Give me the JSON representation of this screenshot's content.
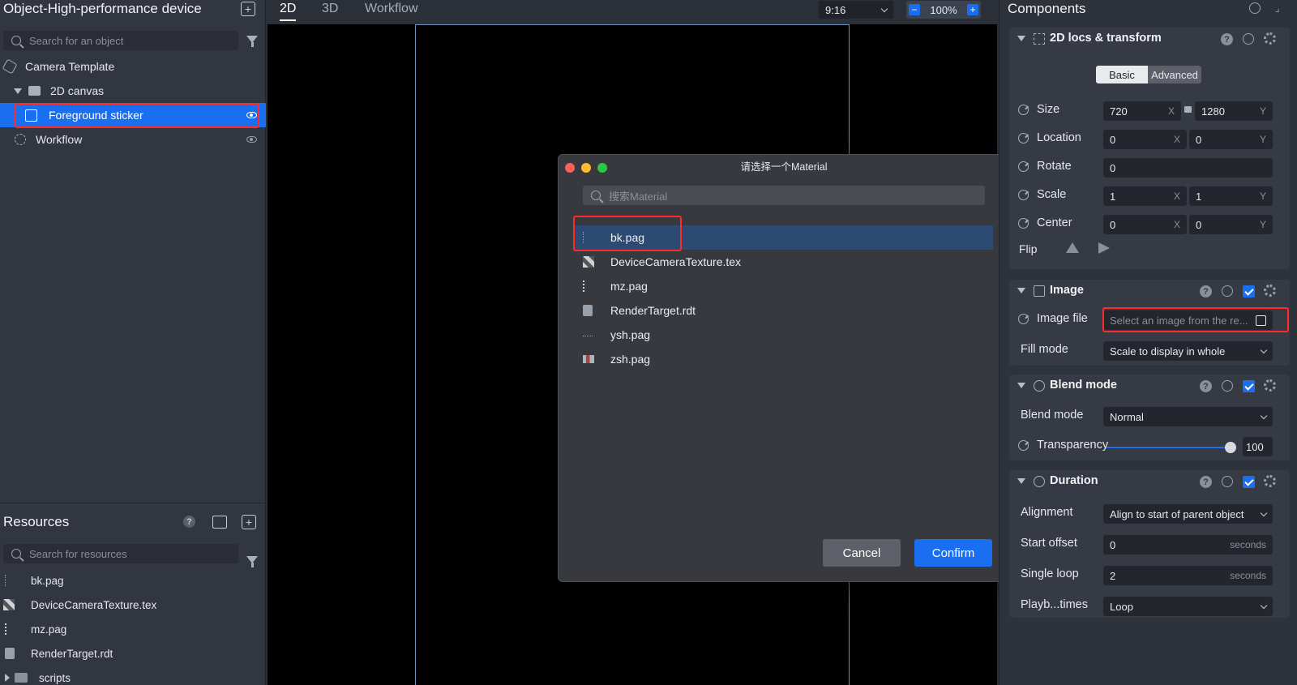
{
  "left": {
    "title": "Object-High-performance device",
    "search_placeholder": "Search for an object",
    "tree": [
      {
        "label": "Camera Template"
      },
      {
        "label": "2D canvas"
      },
      {
        "label": "Foreground sticker"
      },
      {
        "label": "Workflow"
      }
    ],
    "resources_title": "Resources",
    "resources_search_placeholder": "Search for resources",
    "resources": [
      {
        "label": "bk.pag"
      },
      {
        "label": "DeviceCameraTexture.tex"
      },
      {
        "label": "mz.pag"
      },
      {
        "label": "RenderTarget.rdt"
      },
      {
        "label": "scripts"
      }
    ]
  },
  "top": {
    "tabs": [
      "2D",
      "3D",
      "Workflow"
    ],
    "aspect": "9:16",
    "zoom": "100%",
    "zoom_minus": "−",
    "zoom_plus": "+"
  },
  "dialog": {
    "title": "请选择一个Material",
    "search_placeholder": "搜索Material",
    "items": [
      {
        "label": "bk.pag"
      },
      {
        "label": "DeviceCameraTexture.tex"
      },
      {
        "label": "mz.pag"
      },
      {
        "label": "RenderTarget.rdt"
      },
      {
        "label": "ysh.pag"
      },
      {
        "label": "zsh.pag"
      }
    ],
    "cancel": "Cancel",
    "confirm": "Confirm"
  },
  "right": {
    "title": "Components",
    "transform": {
      "title": "2D locs & transform",
      "seg_basic": "Basic",
      "seg_advanced": "Advanced",
      "size_label": "Size",
      "size_x": "720",
      "size_y": "1280",
      "location_label": "Location",
      "location_x": "0",
      "location_y": "0",
      "rotate_label": "Rotate",
      "rotate_value": "0",
      "scale_label": "Scale",
      "scale_x": "1",
      "scale_y": "1",
      "center_label": "Center",
      "center_x": "0",
      "center_y": "0",
      "flip_label": "Flip",
      "axis_x": "X",
      "axis_y": "Y"
    },
    "image": {
      "title": "Image",
      "file_label": "Image file",
      "file_placeholder": "Select an image from the re...",
      "fill_label": "Fill mode",
      "fill_value": "Scale to display in whole"
    },
    "blend": {
      "title": "Blend mode",
      "mode_label": "Blend mode",
      "mode_value": "Normal",
      "transparency_label": "Transparency",
      "transparency_value": "100",
      "transparency_level": 1.0
    },
    "duration": {
      "title": "Duration",
      "alignment_label": "Alignment",
      "alignment_value": "Align to start of parent object",
      "start_label": "Start offset",
      "start_value": "0",
      "loop_label": "Single loop",
      "loop_value": "2",
      "unit": "seconds",
      "playback_label": "Playb...times",
      "playback_value": "Loop"
    }
  },
  "colors": {
    "accent": "#1a6ff0",
    "highlight": "#ff2a2a"
  }
}
